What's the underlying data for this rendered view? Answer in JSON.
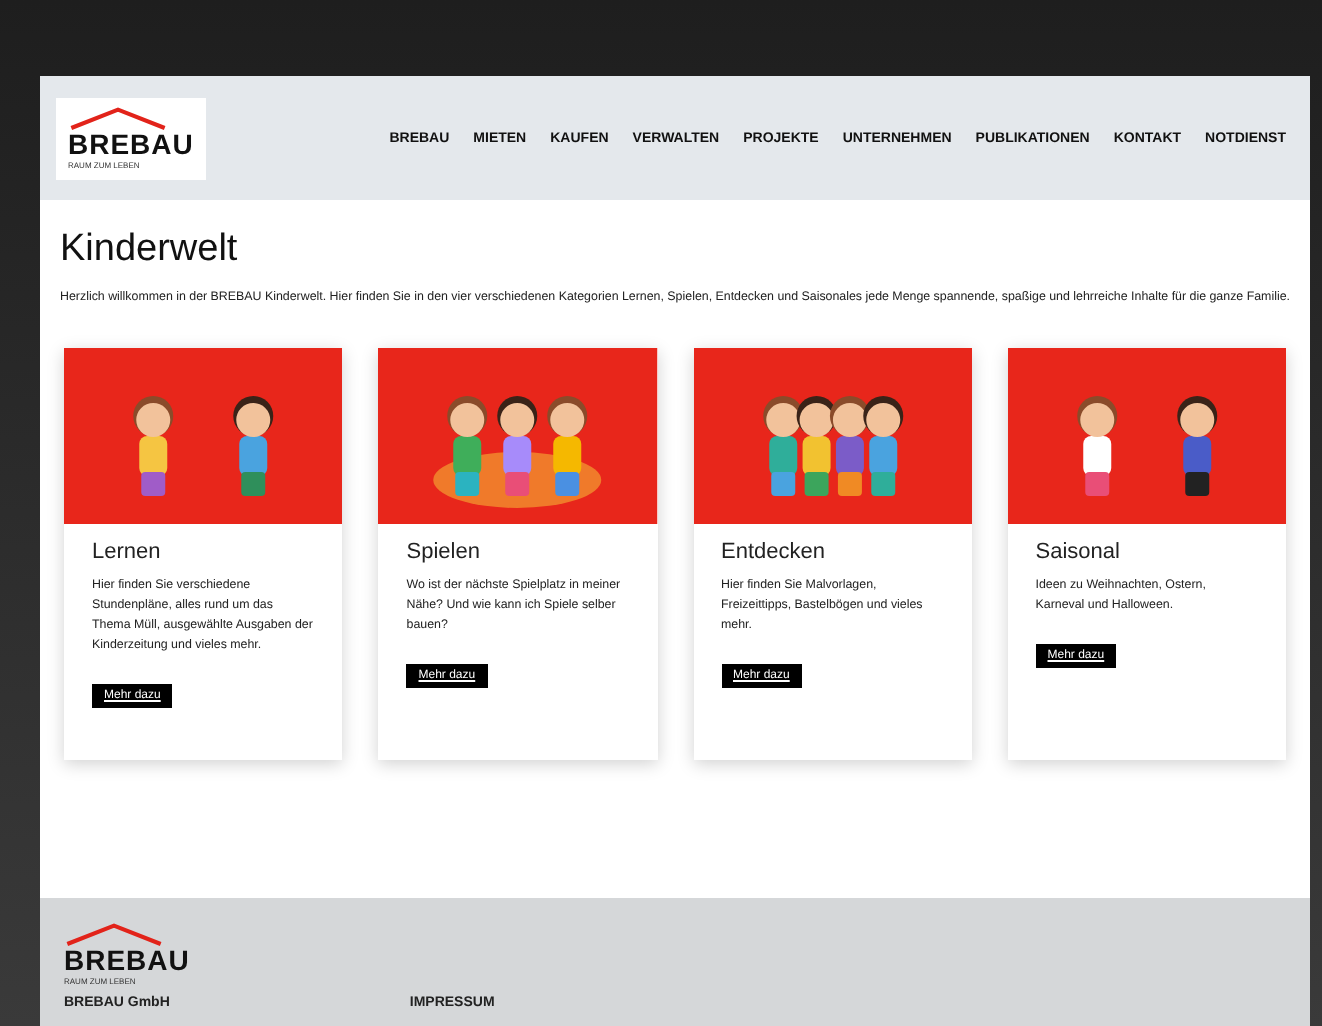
{
  "header": {
    "logo": {
      "name": "BREBAU",
      "tagline": "RAUM ZUM LEBEN"
    },
    "nav": [
      "BREBAU",
      "MIETEN",
      "KAUFEN",
      "VERWALTEN",
      "PROJEKTE",
      "UNTERNEHMEN",
      "PUBLIKATIONEN",
      "KONTAKT",
      "NOTDIENST"
    ]
  },
  "page": {
    "title": "Kinderwelt",
    "intro": "Herzlich willkommen in der BREBAU Kinderwelt. Hier finden Sie in den vier verschiedenen Kategorien Lernen, Spielen, Entdecken und Saisonales jede Menge spannende, spaßige und lehrreiche Inhalte für die ganze Familie."
  },
  "cards": [
    {
      "title": "Lernen",
      "text": "Hier finden Sie verschiedene Stundenpläne, alles rund um das Thema Müll, ausgewählte Ausgaben der Kinderzeitung und vieles mehr.",
      "button": "Mehr dazu"
    },
    {
      "title": "Spielen",
      "text": "Wo ist der nächste Spielplatz in meiner Nähe? Und wie kann ich Spiele selber bauen?",
      "button": "Mehr dazu"
    },
    {
      "title": "Entdecken",
      "text": "Hier finden Sie Malvorlagen, Freizeittipps, Bastelbögen und vieles mehr.",
      "button": "Mehr dazu"
    },
    {
      "title": "Saisonal",
      "text": "Ideen zu Weihnachten, Ostern, Karneval und Halloween.",
      "button": "Mehr dazu"
    }
  ],
  "footer": {
    "logo": {
      "name": "BREBAU",
      "tagline": "RAUM ZUM LEBEN"
    },
    "company": "BREBAU GmbH",
    "link": "IMPRESSUM"
  }
}
